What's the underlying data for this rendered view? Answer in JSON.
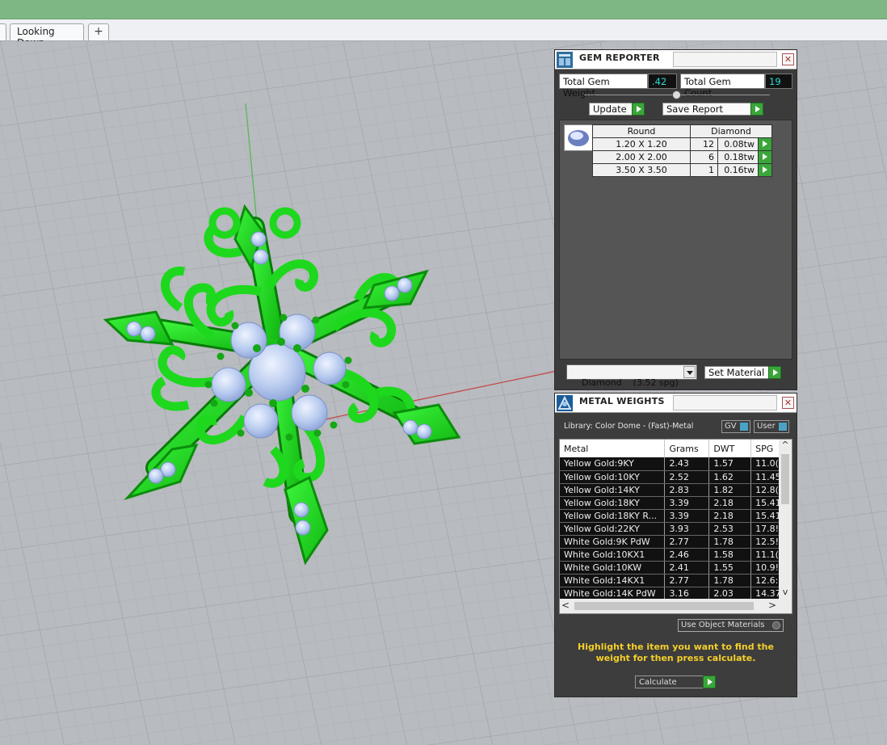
{
  "tabs": {
    "active": "Looking Down",
    "add_symbol": "+"
  },
  "gem_reporter": {
    "title": "GEM REPORTER",
    "close_symbol": "✕",
    "total_weight_label": "Total Gem Weight",
    "total_weight_value": ".42",
    "total_count_label": "Total Gem Count",
    "total_count_value": "19",
    "update_label": "Update",
    "save_label": "Save Report",
    "shape_header": "Round",
    "material_header": "Diamond",
    "rows": [
      {
        "size": "1.20 X 1.20",
        "count": "12",
        "weight": "0.08tw"
      },
      {
        "size": "2.00 X 2.00",
        "count": "6",
        "weight": "0.18tw"
      },
      {
        "size": "3.50 X 3.50",
        "count": "1",
        "weight": "0.16tw"
      }
    ],
    "material_select": "Diamond    (3.52 spg)",
    "set_material_label": "Set Material"
  },
  "metal_weights": {
    "title": "METAL WEIGHTS",
    "close_symbol": "✕",
    "library": "Library: Color Dome - (Fast)-Metal",
    "gv_label": "GV",
    "user_label": "User",
    "columns": [
      "Metal",
      "Grams",
      "DWT",
      "SPG"
    ],
    "rows": [
      {
        "metal": "Yellow Gold:9KY",
        "grams": "2.43",
        "dwt": "1.57",
        "spg": "11.0("
      },
      {
        "metal": "Yellow Gold:10KY",
        "grams": "2.52",
        "dwt": "1.62",
        "spg": "11.45"
      },
      {
        "metal": "Yellow Gold:14KY",
        "grams": "2.83",
        "dwt": "1.82",
        "spg": "12.8("
      },
      {
        "metal": "Yellow Gold:18KY",
        "grams": "3.39",
        "dwt": "2.18",
        "spg": "15.41"
      },
      {
        "metal": "Yellow Gold:18KY R...",
        "grams": "3.39",
        "dwt": "2.18",
        "spg": "15.41"
      },
      {
        "metal": "Yellow Gold:22KY",
        "grams": "3.93",
        "dwt": "2.53",
        "spg": "17.8!"
      },
      {
        "metal": "White Gold:9K PdW",
        "grams": "2.77",
        "dwt": "1.78",
        "spg": "12.5!"
      },
      {
        "metal": "White Gold:10KX1",
        "grams": "2.46",
        "dwt": "1.58",
        "spg": "11.1("
      },
      {
        "metal": "White Gold:10KW",
        "grams": "2.41",
        "dwt": "1.55",
        "spg": "10.9!"
      },
      {
        "metal": "White Gold:14KX1",
        "grams": "2.77",
        "dwt": "1.78",
        "spg": "12.6:"
      },
      {
        "metal": "White Gold:14K PdW",
        "grams": "3.16",
        "dwt": "2.03",
        "spg": "14.37"
      }
    ],
    "scroll_left": "<",
    "scroll_right": ">",
    "scroll_up": "^",
    "scroll_down": "v",
    "use_object_materials": "Use Object Materials",
    "hint": "Highlight the item you want to find the weight for then press calculate.",
    "calculate_label": "Calculate"
  },
  "colors": {
    "titlebar_accent": "#7fb784",
    "model_green": "#22e022",
    "gem_blue": "#c8daf5",
    "hint_yellow": "#f4cf2a"
  }
}
